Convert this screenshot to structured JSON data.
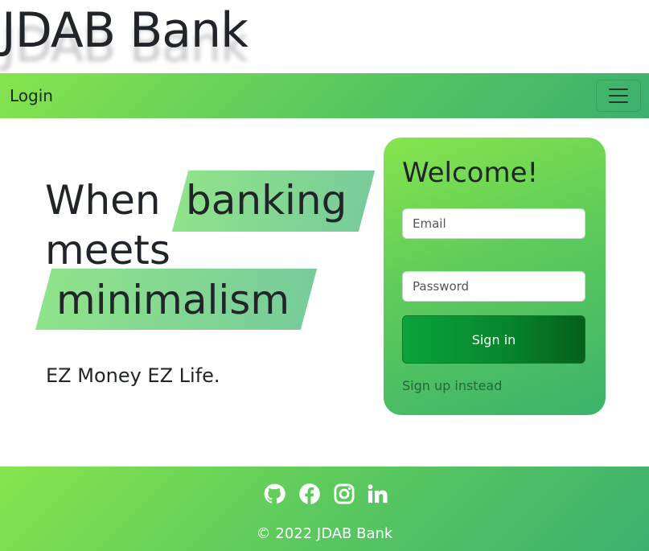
{
  "brand": {
    "title": "JDAB Bank"
  },
  "navbar": {
    "link": "Login",
    "toggler_icon": "hamburger-menu-icon"
  },
  "hero": {
    "word_when": "When",
    "word_banking": "banking",
    "word_meets": "meets",
    "word_minimalism": "minimalism",
    "tagline": "EZ Money EZ Life.",
    "highlight_color": "#86e08f"
  },
  "login_card": {
    "title": "Welcome!",
    "email_placeholder": "Email",
    "password_placeholder": "Password",
    "signin_label": "Sign in",
    "signup_link": "Sign up instead"
  },
  "footer": {
    "icons": [
      "github-icon",
      "facebook-icon",
      "instagram-icon",
      "linkedin-icon"
    ],
    "copyright": "© 2022 JDAB Bank"
  },
  "colors": {
    "gradient_start": "#86e54d",
    "gradient_end": "#3cb06f",
    "button_green": "#07872d"
  }
}
